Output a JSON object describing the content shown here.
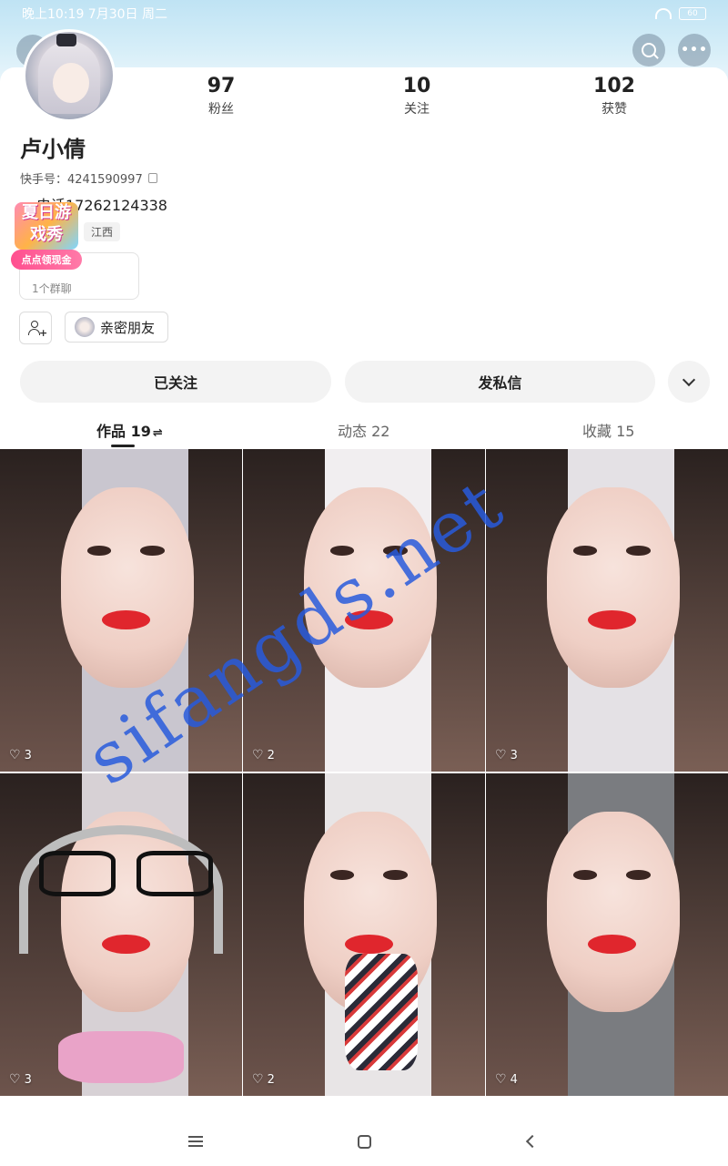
{
  "status_bar": {
    "time": "晚上10:19 7月30日 周二",
    "battery": "60"
  },
  "profile": {
    "name": "卢小倩",
    "kuaishou_id_label": "快手号：4241590997",
    "phone": "电话17262124338",
    "region": "江西",
    "group_chat": "1个群聊",
    "close_friend_label": "亲密朋友"
  },
  "stats": [
    {
      "value": "97",
      "label": "粉丝"
    },
    {
      "value": "10",
      "label": "关注"
    },
    {
      "value": "102",
      "label": "获赞"
    }
  ],
  "promo": {
    "title": "夏日游戏秀",
    "pill": "点点领现金"
  },
  "actions": {
    "follow": "已关注",
    "message": "发私信"
  },
  "tabs": [
    {
      "label": "作品 19",
      "swap": "⇌"
    },
    {
      "label": "动态 22"
    },
    {
      "label": "收藏 15"
    }
  ],
  "posts": [
    {
      "likes": "3"
    },
    {
      "likes": "2"
    },
    {
      "likes": "3"
    },
    {
      "likes": "3"
    },
    {
      "likes": "2"
    },
    {
      "likes": "4"
    }
  ],
  "watermark": "sifangds.net",
  "icons": {
    "back": "back-arrow-icon",
    "search": "search-icon",
    "more": "more-dots-icon",
    "copy": "copy-icon",
    "add_friend": "add-friend-icon",
    "dropdown": "chevron-down-icon",
    "heart": "heart-icon"
  }
}
